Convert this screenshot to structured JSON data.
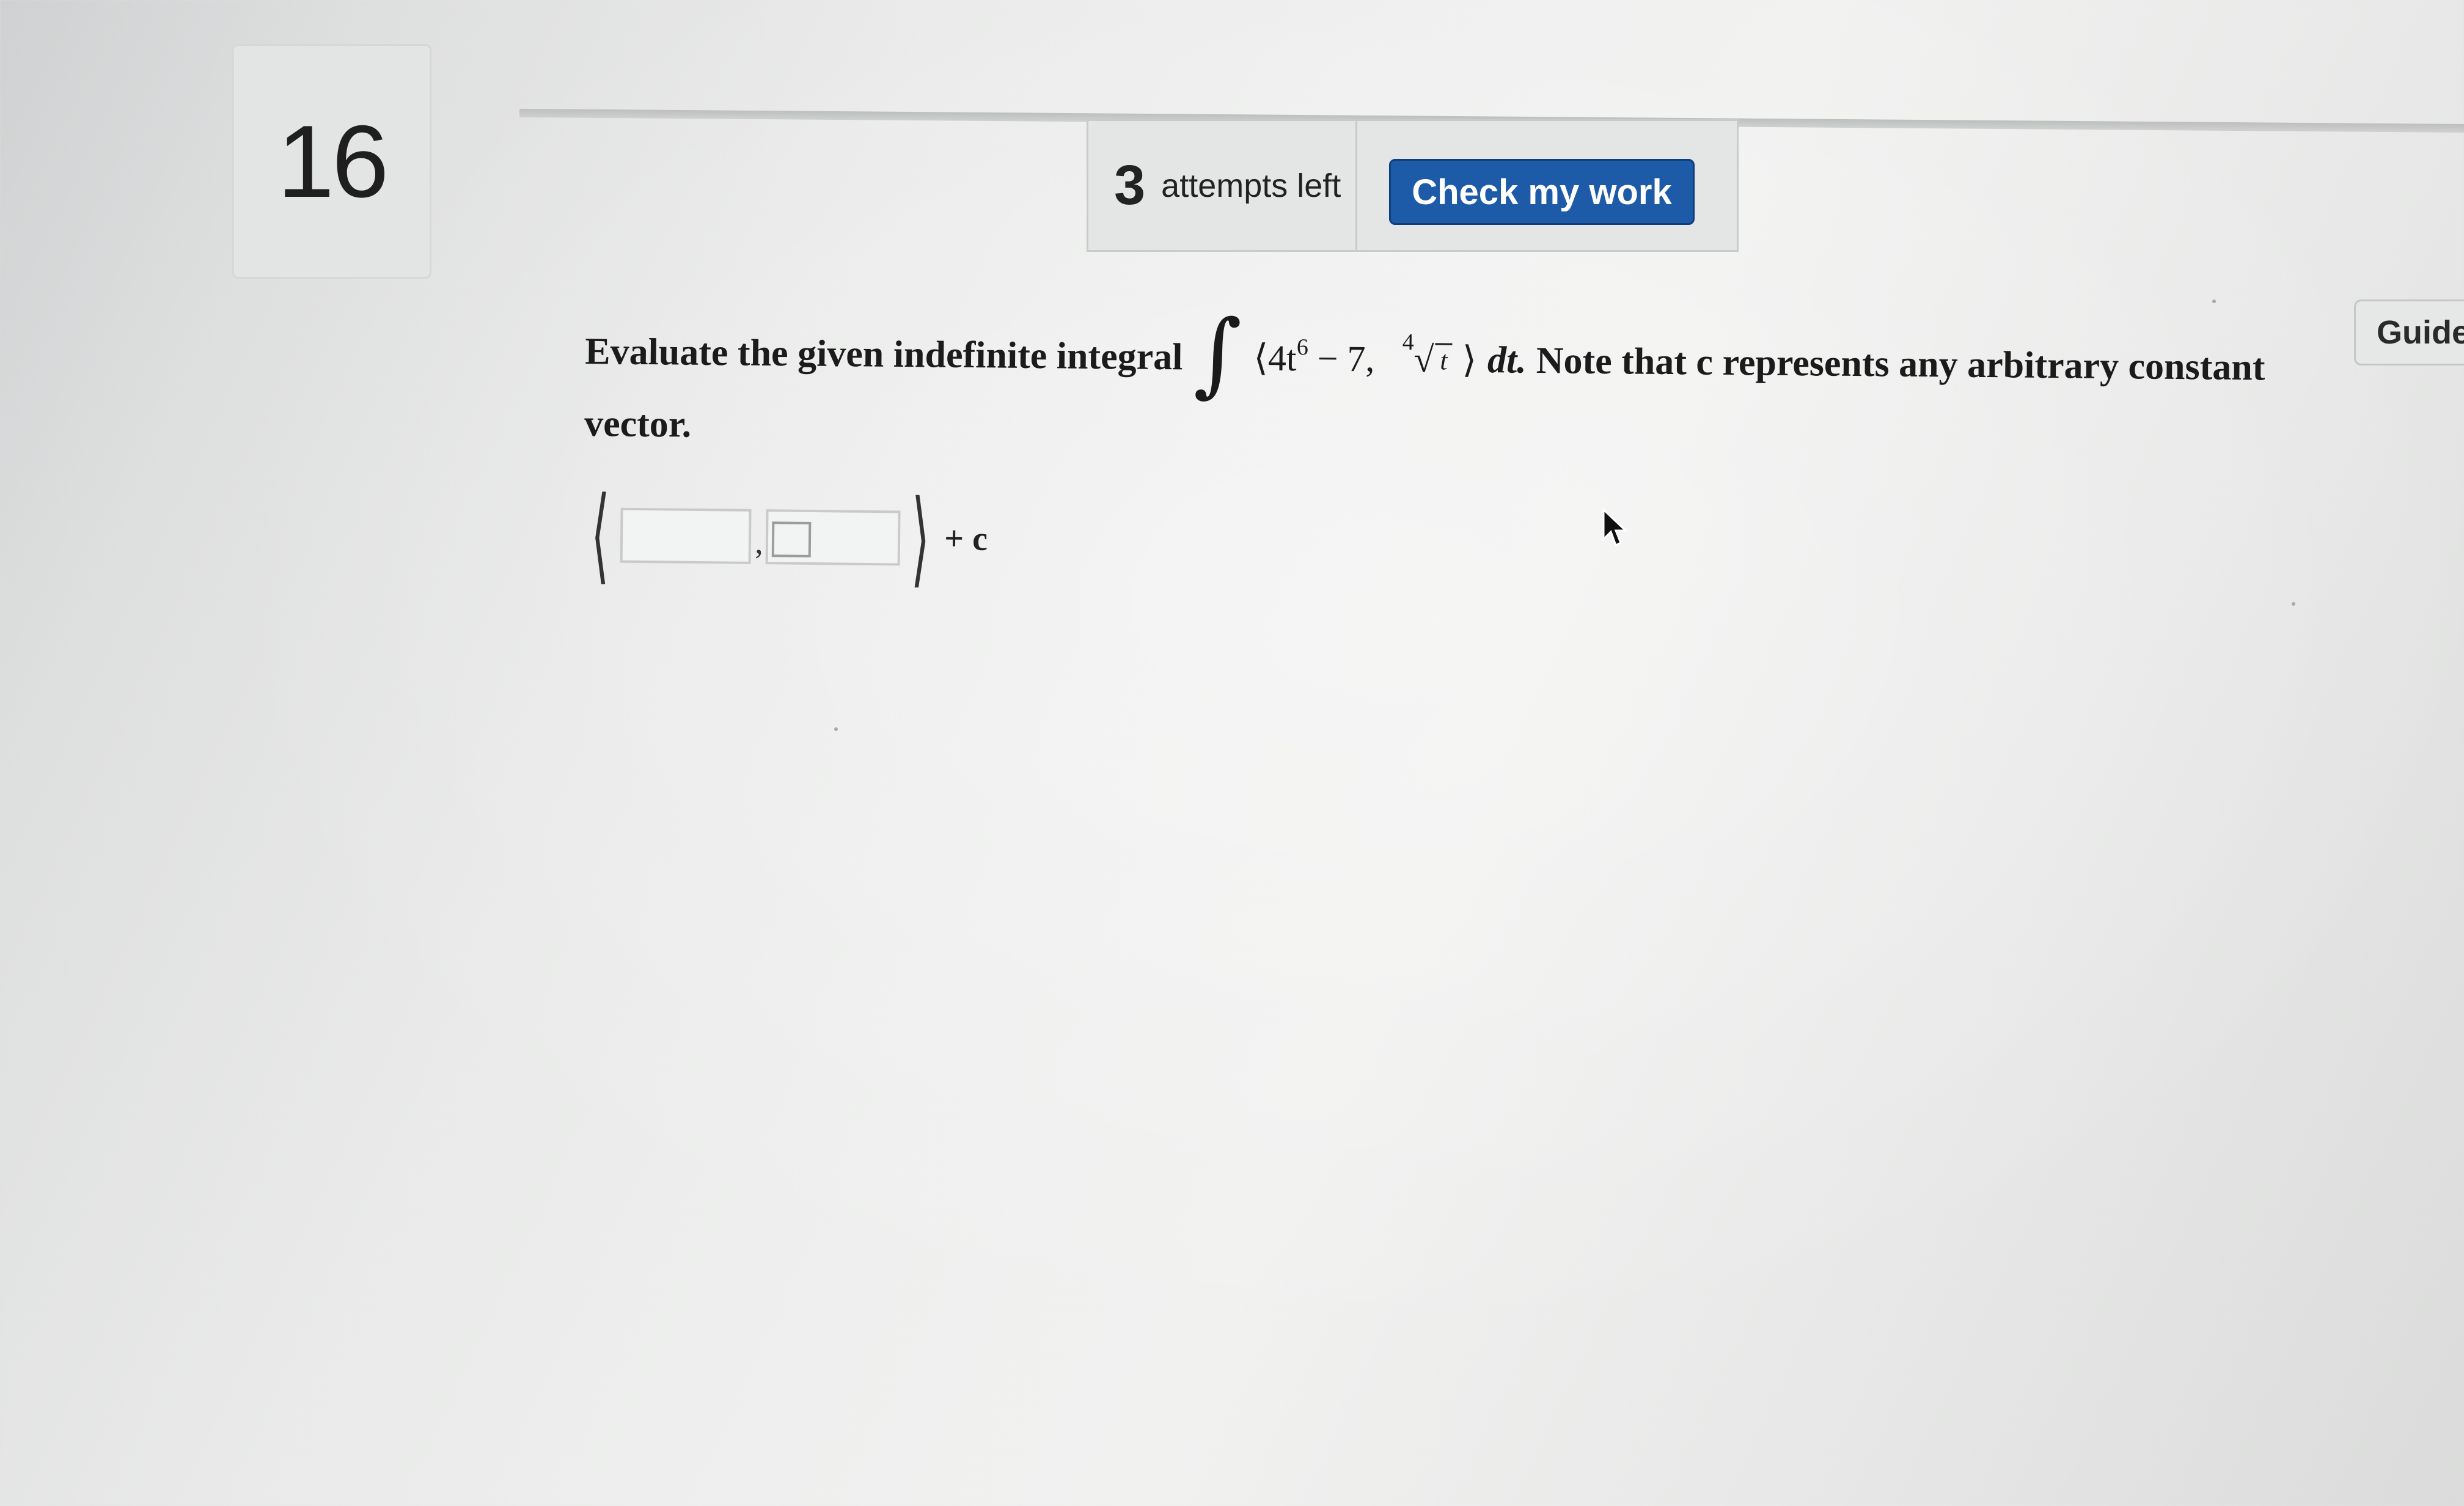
{
  "question_number": "16",
  "attempts": {
    "count": "3",
    "label": "attempts left"
  },
  "buttons": {
    "check_my_work": "Check my work",
    "guide": "Guide"
  },
  "question": {
    "prefix": "Evaluate the given indefinite integral",
    "integral_symbol": "∫",
    "integrand": {
      "open_angle": "⟨",
      "term1_base": "4t",
      "term1_exponent": "6",
      "term1_rest": " − 7, ",
      "root_index": "4",
      "root_radicand": "t",
      "close_angle": "⟩"
    },
    "dt": "dt.",
    "suffix": "Note that c represents any arbitrary constant",
    "line2": "vector."
  },
  "answer": {
    "open_bracket": "⟨",
    "comma": ",",
    "close_bracket": "⟩",
    "plus_c": "+ c"
  },
  "colors": {
    "button_blue": "#1d5aa8",
    "page_bg": "#e9eae9"
  }
}
